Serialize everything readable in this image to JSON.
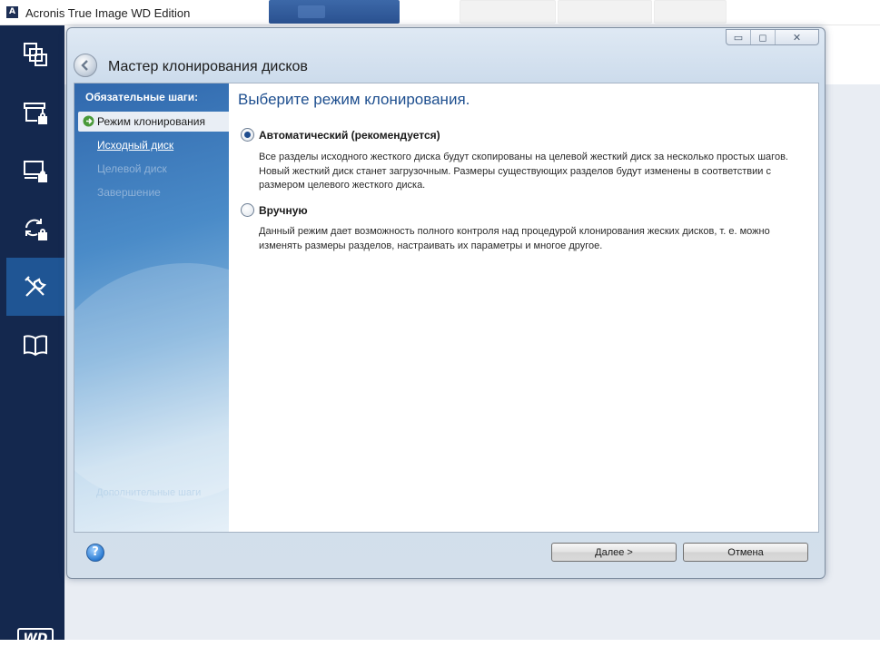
{
  "app": {
    "title": "Acronis True Image WD Edition",
    "logo_letter": "A"
  },
  "nav": {
    "items": [
      {
        "name": "backup-icon",
        "active": false
      },
      {
        "name": "archive-lock-icon",
        "active": false
      },
      {
        "name": "computer-lock-icon",
        "active": false
      },
      {
        "name": "sync-lock-icon",
        "active": false
      },
      {
        "name": "tools-icon",
        "active": true
      },
      {
        "name": "book-icon",
        "active": false
      }
    ],
    "brand": "WD"
  },
  "wizard": {
    "title": "Мастер клонирования дисков",
    "controls": {
      "minimize": "▭",
      "maximize": "◻",
      "close": "✕"
    },
    "sidebar": {
      "header": "Обязательные шаги:",
      "steps": [
        {
          "label": "Режим клонирования",
          "state": "current"
        },
        {
          "label": "Исходный диск",
          "state": "link"
        },
        {
          "label": "Целевой диск",
          "state": "disabled"
        },
        {
          "label": "Завершение",
          "state": "disabled"
        }
      ],
      "faded_label": "Дополнительные шаги"
    },
    "content": {
      "heading": "Выберите режим клонирования.",
      "options": [
        {
          "label": "Автоматический (рекомендуется)",
          "selected": true,
          "description": "Все разделы исходного жесткого диска будут скопированы на целевой жесткий диск за несколько простых шагов. Новый жесткий диск станет загрузочным. Размеры существующих разделов будут изменены в соответствии с размером целевого жесткого диска."
        },
        {
          "label": "Вручную",
          "selected": false,
          "description": "Данный режим дает возможность полного контроля над процедурой клонирования жеских дисков, т. е. можно изменять размеры разделов, настраивать их параметры и многое другое."
        }
      ]
    },
    "footer": {
      "help": "?",
      "next": "Далее >",
      "cancel": "Отмена"
    }
  },
  "colors": {
    "nav_bg": "#14284e",
    "nav_active": "#1f5594",
    "heading": "#1e4f8f"
  }
}
